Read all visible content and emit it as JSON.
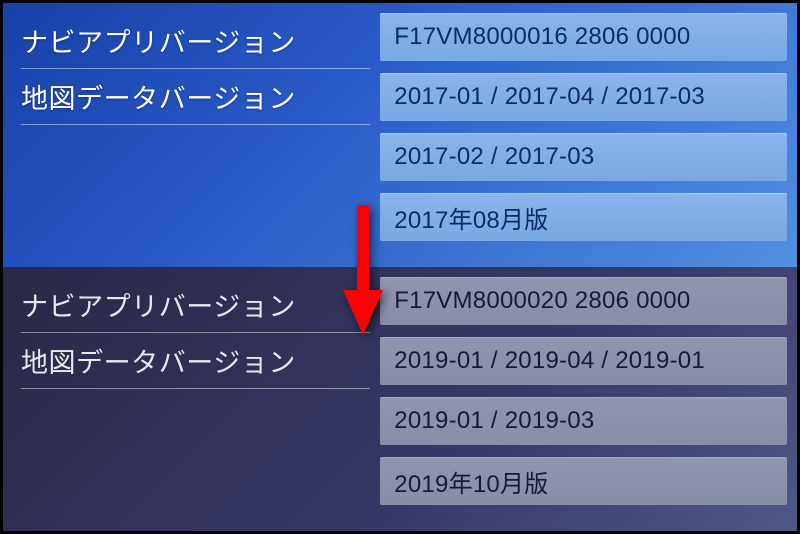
{
  "top": {
    "navi_label": "ナビアプリバージョン",
    "map_label": "地図データバージョン",
    "navi_version": "F17VM8000016 2806 0000",
    "map_version_1": "2017-01 / 2017-04 / 2017-03",
    "map_version_2": "2017-02 / 2017-03",
    "map_edition": "2017年08月版"
  },
  "bottom": {
    "navi_label": "ナビアプリバージョン",
    "map_label": "地図データバージョン",
    "navi_version": "F17VM8000020 2806 0000",
    "map_version_1": "2019-01 / 2019-04 / 2019-01",
    "map_version_2": "2019-01 / 2019-03",
    "map_edition": "2019年10月版"
  }
}
